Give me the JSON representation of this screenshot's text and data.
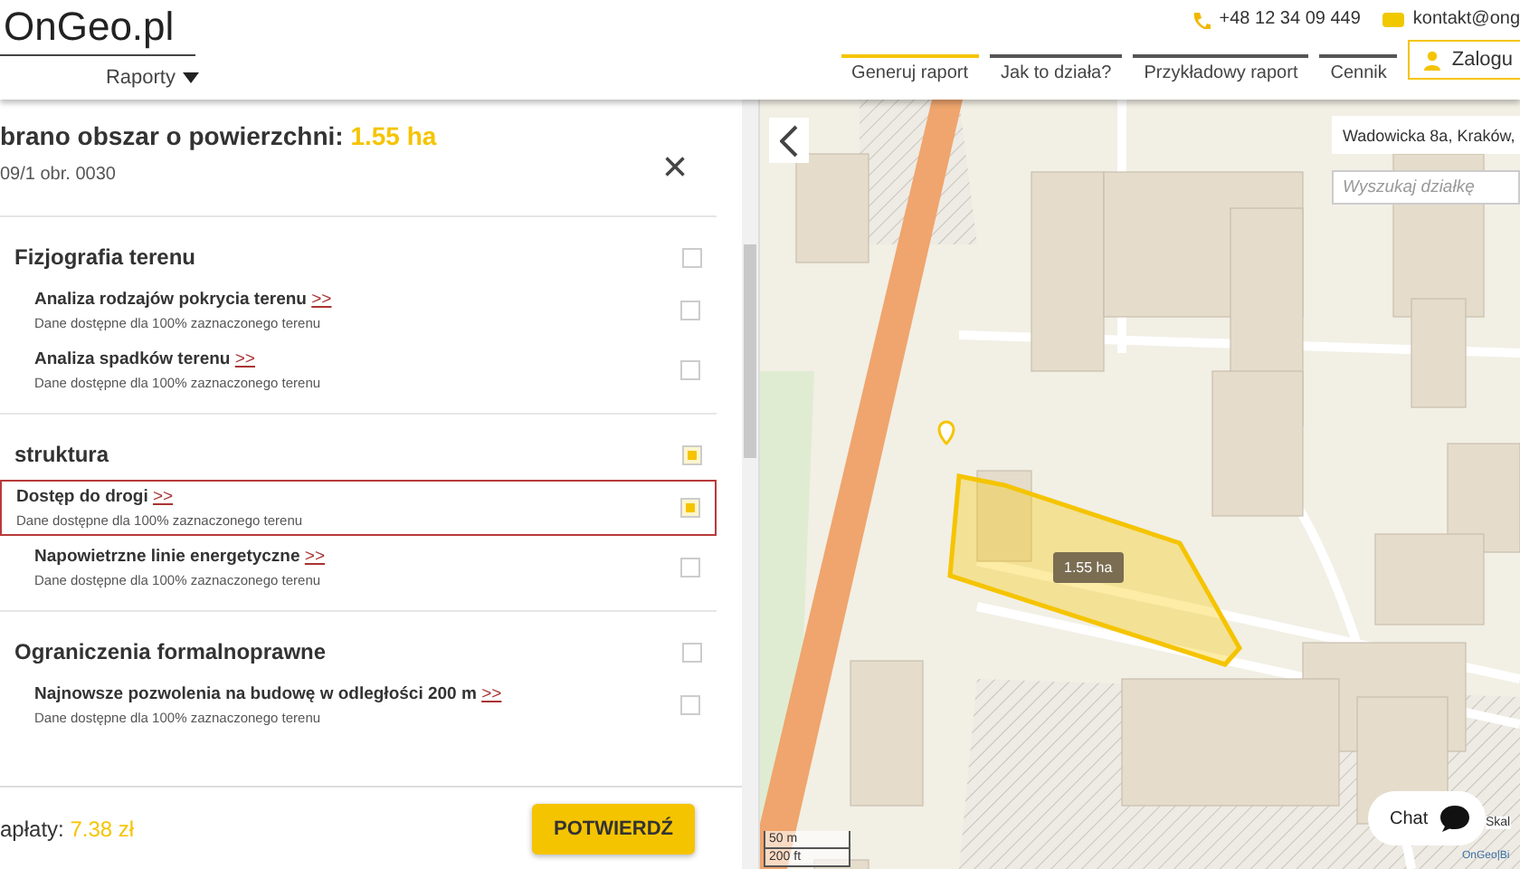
{
  "header": {
    "logo": "OnGeo.pl",
    "menu": "Raporty",
    "phone": "+48 12 34 09 449",
    "email": "kontakt@ong",
    "nav": [
      {
        "label": "Generuj raport",
        "selected": true
      },
      {
        "label": "Jak to działa?",
        "selected": false
      },
      {
        "label": "Przykładowy raport",
        "selected": false
      },
      {
        "label": "Cennik",
        "selected": false
      }
    ],
    "login": "Zalogu"
  },
  "panel": {
    "title": "brano obszar o powierzchni: ",
    "area": "1.55 ha",
    "subtitle": "09/1 obr. 0030",
    "close": "×",
    "groups": [
      {
        "title": "Fizjografia terenu",
        "checked": false,
        "items": [
          {
            "title": "Analiza rodzajów pokrycia terenu",
            "link": ">>",
            "note": "Dane dostępne dla 100% zaznaczonego terenu",
            "checked": false,
            "highlighted": false
          },
          {
            "title": "Analiza spadków terenu",
            "link": ">>",
            "note": "Dane dostępne dla 100% zaznaczonego terenu",
            "checked": false,
            "highlighted": false
          }
        ]
      },
      {
        "title": "struktura",
        "checked": true,
        "items": [
          {
            "title": "Dostęp do drogi",
            "link": ">>",
            "note": "Dane dostępne dla 100% zaznaczonego terenu",
            "checked": true,
            "highlighted": true
          },
          {
            "title": "Napowietrzne linie energetyczne",
            "link": ">>",
            "note": "Dane dostępne dla 100% zaznaczonego terenu",
            "checked": false,
            "highlighted": false
          }
        ]
      },
      {
        "title": "Ograniczenia formalnoprawne",
        "checked": false,
        "items": [
          {
            "title": "Najnowsze pozwolenia na budowę w odległości 200 m",
            "link": ">>",
            "note": "Dane dostępne dla 100% zaznaczonego terenu",
            "checked": false,
            "highlighted": false
          }
        ]
      }
    ],
    "price_label": "apłaty: ",
    "price": "7.38 zł",
    "confirm": "POTWIERDŹ"
  },
  "map": {
    "address": "Wadowicka 8a, Kraków,",
    "search_placeholder": "Wyszukaj działkę",
    "area_label": "1.55 ha",
    "chat": "Chat",
    "scale_m": "50 m",
    "scale_ft": "200 ft",
    "side_label": "Skal",
    "attribution": "OnGeo|Bi"
  }
}
